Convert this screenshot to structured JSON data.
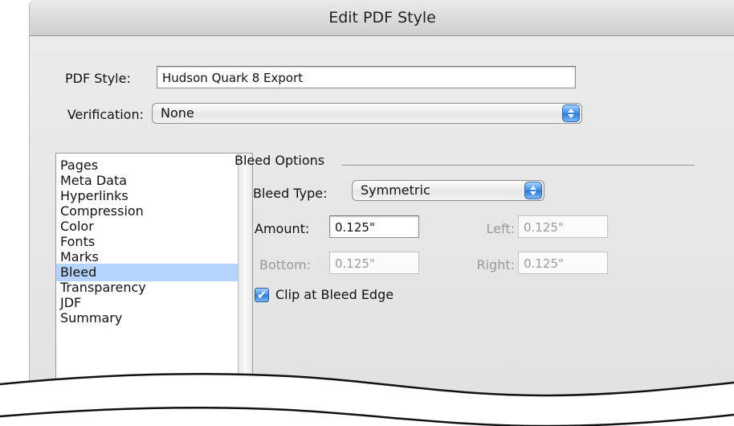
{
  "window": {
    "title": "Edit PDF Style"
  },
  "pdf_style": {
    "label": "PDF Style:",
    "value": "Hudson Quark 8 Export"
  },
  "verification": {
    "label": "Verification:",
    "value": "None"
  },
  "sidebar": {
    "items": [
      {
        "label": "Pages"
      },
      {
        "label": "Meta Data"
      },
      {
        "label": "Hyperlinks"
      },
      {
        "label": "Compression"
      },
      {
        "label": "Color"
      },
      {
        "label": "Fonts"
      },
      {
        "label": "Marks"
      },
      {
        "label": "Bleed",
        "selected": true
      },
      {
        "label": "Transparency"
      },
      {
        "label": "JDF"
      },
      {
        "label": "Summary"
      }
    ]
  },
  "bleed": {
    "group_title": "Bleed Options",
    "type_label": "Bleed Type:",
    "type_value": "Symmetric",
    "amount_label": "Amount:",
    "amount_value": "0.125\"",
    "left_label": "Left:",
    "left_value": "0.125\"",
    "bottom_label": "Bottom:",
    "bottom_value": "0.125\"",
    "right_label": "Right:",
    "right_value": "0.125\"",
    "clip_label": "Clip at Bleed Edge",
    "clip_checked": true
  },
  "colors": {
    "selection": "#b5d5ff",
    "accent": "#3a8be6"
  },
  "icons": {
    "popup_arrows": "up-down-arrows-icon",
    "checkbox": "checkmark-icon"
  }
}
